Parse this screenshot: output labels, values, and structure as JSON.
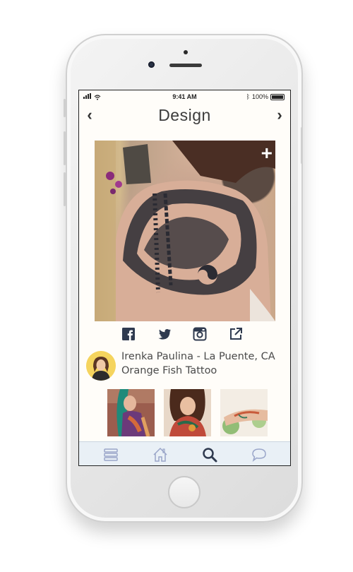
{
  "status_bar": {
    "time": "9:41 AM",
    "battery": "100%"
  },
  "nav": {
    "title": "Design",
    "back": "‹",
    "forward": "›"
  },
  "hero": {
    "add_label": "+"
  },
  "share": {
    "icons": [
      "facebook-icon",
      "twitter-icon",
      "instagram-icon",
      "external-link-icon"
    ]
  },
  "artist": {
    "line1": "Irenka Paulina - La Puente, CA",
    "line2": "Orange Fish Tattoo"
  },
  "tabs": [
    "menu-icon",
    "home-icon",
    "search-icon",
    "chat-icon"
  ],
  "colors": {
    "tab_active": "#2f3a4f",
    "tab_inactive": "#9aa6c9",
    "tab_bg": "#e9f0f6"
  }
}
